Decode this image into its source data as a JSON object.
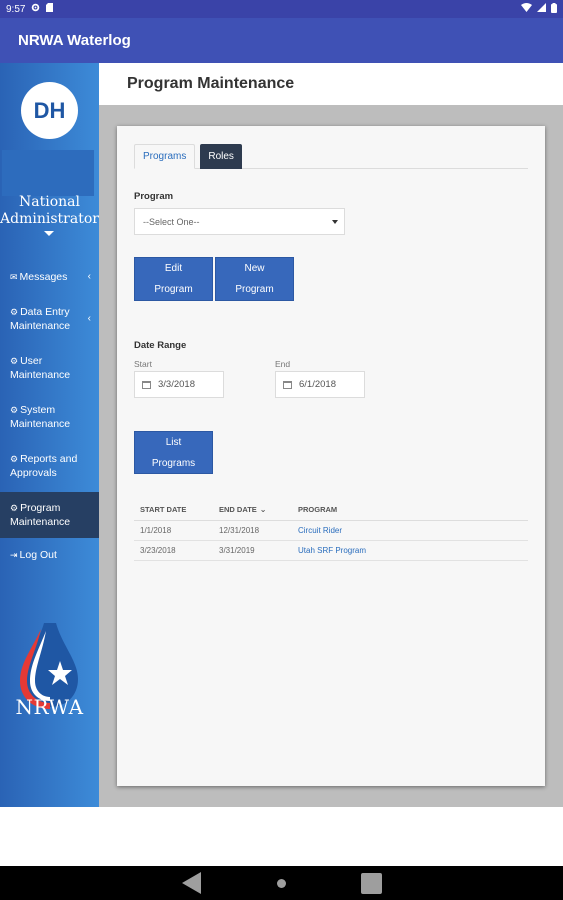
{
  "status_bar": {
    "time": "9:57",
    "left_icons": [
      "gear-icon",
      "sd-card-icon"
    ],
    "right_icons": [
      "wifi-icon",
      "signal-icon",
      "battery-icon"
    ]
  },
  "app_bar": {
    "title": "NRWA Waterlog"
  },
  "sidebar": {
    "avatar_initials": "DH",
    "user_role": "National Administrator",
    "items": [
      {
        "label": "Messages",
        "icon": "envelope-icon",
        "has_chevron": true
      },
      {
        "label": "Data Entry Maintenance",
        "icon": "gear-icon",
        "has_chevron": true
      },
      {
        "label": "User Maintenance",
        "icon": "gear-icon",
        "has_chevron": false
      },
      {
        "label": "System Maintenance",
        "icon": "gear-icon",
        "has_chevron": false
      },
      {
        "label": "Reports and Approvals",
        "icon": "gear-icon",
        "has_chevron": false
      },
      {
        "label": "Program Maintenance",
        "icon": "gear-icon",
        "has_chevron": false,
        "active": true
      },
      {
        "label": "Log Out",
        "icon": "logout-icon",
        "has_chevron": false
      }
    ],
    "logo_text": "NRWA"
  },
  "page": {
    "title": "Program Maintenance"
  },
  "tabs": [
    {
      "label": "Programs",
      "active": true
    },
    {
      "label": "Roles",
      "active": false
    }
  ],
  "form": {
    "program_label": "Program",
    "program_select_value": "--Select One--",
    "edit_button": [
      "Edit",
      "Program"
    ],
    "new_button": [
      "New",
      "Program"
    ],
    "date_range_label": "Date Range",
    "start_label": "Start",
    "start_value": "3/3/2018",
    "end_label": "End",
    "end_value": "6/1/2018",
    "list_button": [
      "List",
      "Programs"
    ]
  },
  "table": {
    "headers": [
      "START DATE",
      "END DATE",
      "PROGRAM"
    ],
    "rows": [
      [
        "1/1/2018",
        "12/31/2018",
        "Circuit Rider"
      ],
      [
        "3/23/2018",
        "3/31/2019",
        "Utah SRF Program"
      ]
    ]
  },
  "colors": {
    "app_bar": "#3f51b5",
    "sidebar": "#2a63b5",
    "active_nav": "#263f63",
    "button": "#3768bb",
    "link": "#2a6dbd"
  }
}
